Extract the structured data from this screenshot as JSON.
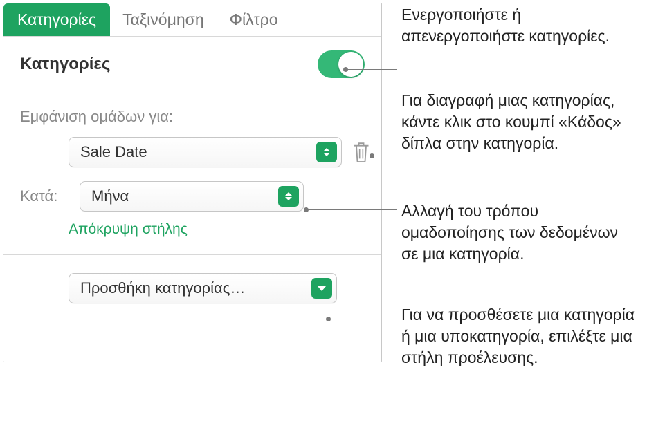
{
  "tabs": {
    "categories": "Κατηγορίες",
    "sort": "Ταξινόμηση",
    "filter": "Φίλτρο"
  },
  "section": {
    "title": "Κατηγορίες"
  },
  "groups_label": "Εμφάνιση ομάδων για:",
  "category_select": {
    "value": "Sale Date"
  },
  "by": {
    "label": "Κατά:",
    "value": "Μήνα"
  },
  "hide_column": "Απόκρυψη στήλης",
  "add_category": "Προσθήκη κατηγορίας…",
  "callouts": {
    "toggle": "Ενεργοποιήστε ή απενεργοποιήστε κατηγορίες.",
    "trash": "Για διαγραφή μιας κατηγορίας, κάντε κλικ στο κουμπί «Κάδος» δίπλα στην κατηγορία.",
    "by": "Αλλαγή του τρόπου ομαδοποίησης των δεδομένων σε μια κατηγορία.",
    "add": "Για να προσθέσετε μια κατηγορία ή μια υποκατηγορία, επιλέξτε μια στήλη προέλευσης."
  }
}
